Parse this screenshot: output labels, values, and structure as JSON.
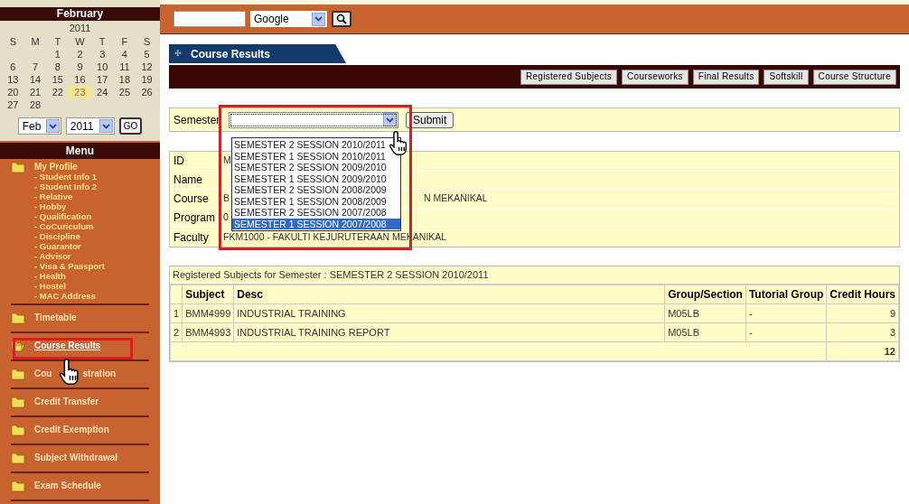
{
  "calendar": {
    "month": "February",
    "year": "2011",
    "weekdays": [
      "S",
      "M",
      "T",
      "W",
      "T",
      "F",
      "S"
    ],
    "weeks": [
      {
        "kind": "leading_gap",
        "days": [
          {
            "d": "1",
            "selected": false
          },
          {
            "d": "2",
            "selected": false
          },
          {
            "d": "3",
            "selected": false
          },
          {
            "d": "4",
            "selected": false
          },
          {
            "d": "5",
            "selected": false
          }
        ]
      },
      {
        "kind": "full",
        "days": [
          {
            "d": "6",
            "selected": false
          },
          {
            "d": "7",
            "selected": false
          },
          {
            "d": "8",
            "selected": false
          },
          {
            "d": "9",
            "selected": false
          },
          {
            "d": "10",
            "selected": false
          },
          {
            "d": "11",
            "selected": false
          },
          {
            "d": "12",
            "selected": false
          }
        ]
      },
      {
        "kind": "full",
        "days": [
          {
            "d": "13",
            "selected": false
          },
          {
            "d": "14",
            "selected": false
          },
          {
            "d": "15",
            "selected": false
          },
          {
            "d": "16",
            "selected": false
          },
          {
            "d": "17",
            "selected": false
          },
          {
            "d": "18",
            "selected": false
          },
          {
            "d": "19",
            "selected": false
          }
        ]
      },
      {
        "kind": "full",
        "days": [
          {
            "d": "20",
            "selected": false
          },
          {
            "d": "21",
            "selected": false
          },
          {
            "d": "22",
            "selected": false
          },
          {
            "d": "23",
            "selected": true
          },
          {
            "d": "24",
            "selected": false
          },
          {
            "d": "25",
            "selected": false
          },
          {
            "d": "26",
            "selected": false
          }
        ]
      },
      {
        "kind": "full",
        "days": [
          {
            "d": "27",
            "selected": false
          },
          {
            "d": "28",
            "selected": false
          }
        ]
      }
    ],
    "month_select": "Feb",
    "year_select": "2011",
    "go_button": "GO"
  },
  "menu": {
    "title": "Menu",
    "items": [
      {
        "label": "My Profile",
        "selected": false,
        "children": [
          "- Student Info 1",
          "- Student Info 2",
          "- Relative",
          "- Hobby",
          "- Qualification",
          "- CoCuriculum",
          "- Discipline",
          "- Guarantor",
          "- Advisor",
          "- Visa & Passport",
          "- Health",
          "- Hostel",
          "- MAC Address"
        ]
      },
      {
        "label": "Timetable",
        "selected": false
      },
      {
        "label": "Course Results",
        "selected": true
      },
      {
        "label": "Cou",
        "label_after": "stration",
        "selected": false
      },
      {
        "label": "Credit Transfer",
        "selected": false
      },
      {
        "label": "Credit Exemption",
        "selected": false
      },
      {
        "label": "Subject Withdrawal",
        "selected": false
      },
      {
        "label": "Exam Schedule",
        "selected": false
      }
    ]
  },
  "search": {
    "engine": "Google"
  },
  "page_tab": {
    "icon": "✣",
    "label": "Course Results"
  },
  "nav_buttons": [
    "Registered Subjects",
    "Courseworks",
    "Final Results",
    "Softskill",
    "Course Structure"
  ],
  "semester_form": {
    "label": "Semester",
    "submit": "Submit",
    "options": [
      {
        "label": "SEMESTER 2 SESSION 2010/2011",
        "selected": false
      },
      {
        "label": "SEMESTER 1 SESSION 2010/2011",
        "selected": false
      },
      {
        "label": "SEMESTER 2 SESSION 2009/2010",
        "selected": false
      },
      {
        "label": "SEMESTER 1 SESSION 2009/2010",
        "selected": false
      },
      {
        "label": "SEMESTER 2 SESSION 2008/2009",
        "selected": false
      },
      {
        "label": "SEMESTER 1 SESSION 2008/2009",
        "selected": false
      },
      {
        "label": "SEMESTER 2 SESSION 2007/2008",
        "selected": false
      },
      {
        "label": "SEMESTER 1 SESSION 2007/2008",
        "selected": true
      }
    ]
  },
  "student_info": [
    {
      "label": "ID",
      "value": "M"
    },
    {
      "label": "Name"
    },
    {
      "label": "Course",
      "value": "B",
      "value_after": "N MEKANIKAL"
    },
    {
      "label": "Program",
      "value": "0"
    },
    {
      "label": "Faculty",
      "value": "FKM1000 - FAKULTI KEJURUTERAAN MEKANIKAL"
    }
  ],
  "registered": {
    "caption": "Registered Subjects for Semester : SEMESTER 2 SESSION 2010/2011",
    "columns": [
      "",
      "Subject",
      "Desc",
      "Group/Section",
      "Tutorial Group",
      "Credit Hours"
    ],
    "rows": [
      [
        "1",
        "BMM4999",
        "INDUSTRIAL TRAINING",
        "M05LB",
        "-",
        "9"
      ],
      [
        "2",
        "BMM4993",
        "INDUSTRIAL TRAINING REPORT",
        "M05LB",
        "-",
        "3"
      ]
    ],
    "total": "12"
  }
}
